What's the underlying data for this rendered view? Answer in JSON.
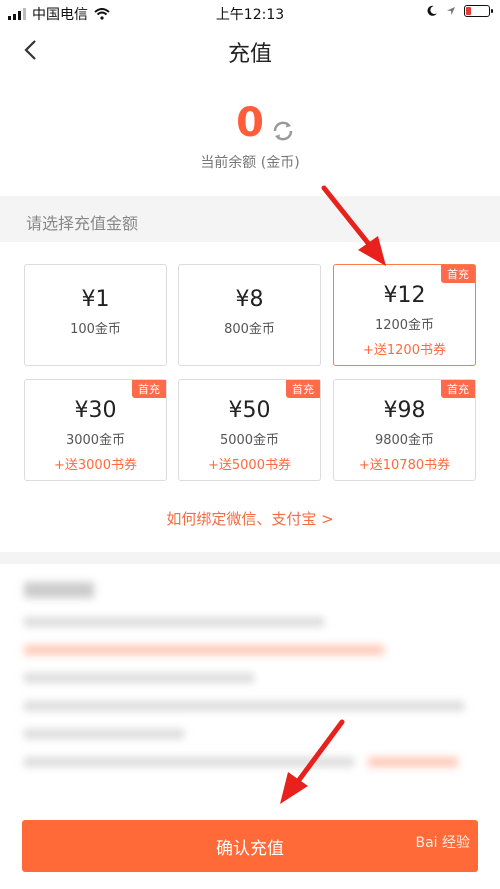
{
  "status_bar": {
    "carrier": "中国电信",
    "time": "上午12:13"
  },
  "nav": {
    "title": "充值",
    "back_icon": "chevron-left-icon"
  },
  "balance": {
    "value": "0",
    "label": "当前余额 (金币)",
    "refresh_icon": "refresh-icon"
  },
  "section_title": "请选择充值金额",
  "options": [
    {
      "price": "¥1",
      "coins": "100金币",
      "bonus": "",
      "badge": ""
    },
    {
      "price": "¥8",
      "coins": "800金币",
      "bonus": "",
      "badge": ""
    },
    {
      "price": "¥12",
      "coins": "1200金币",
      "bonus": "+送1200书券",
      "badge": "首充",
      "selected": true
    },
    {
      "price": "¥30",
      "coins": "3000金币",
      "bonus": "+送3000书券",
      "badge": "首充"
    },
    {
      "price": "¥50",
      "coins": "5000金币",
      "bonus": "+送5000书券",
      "badge": "首充"
    },
    {
      "price": "¥98",
      "coins": "9800金币",
      "bonus": "+送10780书券",
      "badge": "首充"
    }
  ],
  "bind_link": "如何绑定微信、支付宝 >",
  "confirm_button": "确认充值",
  "watermark": "Bai 经验",
  "colors": {
    "accent": "#ff6a38",
    "balance": "#ff5c39",
    "arrow": "#e8211c"
  }
}
